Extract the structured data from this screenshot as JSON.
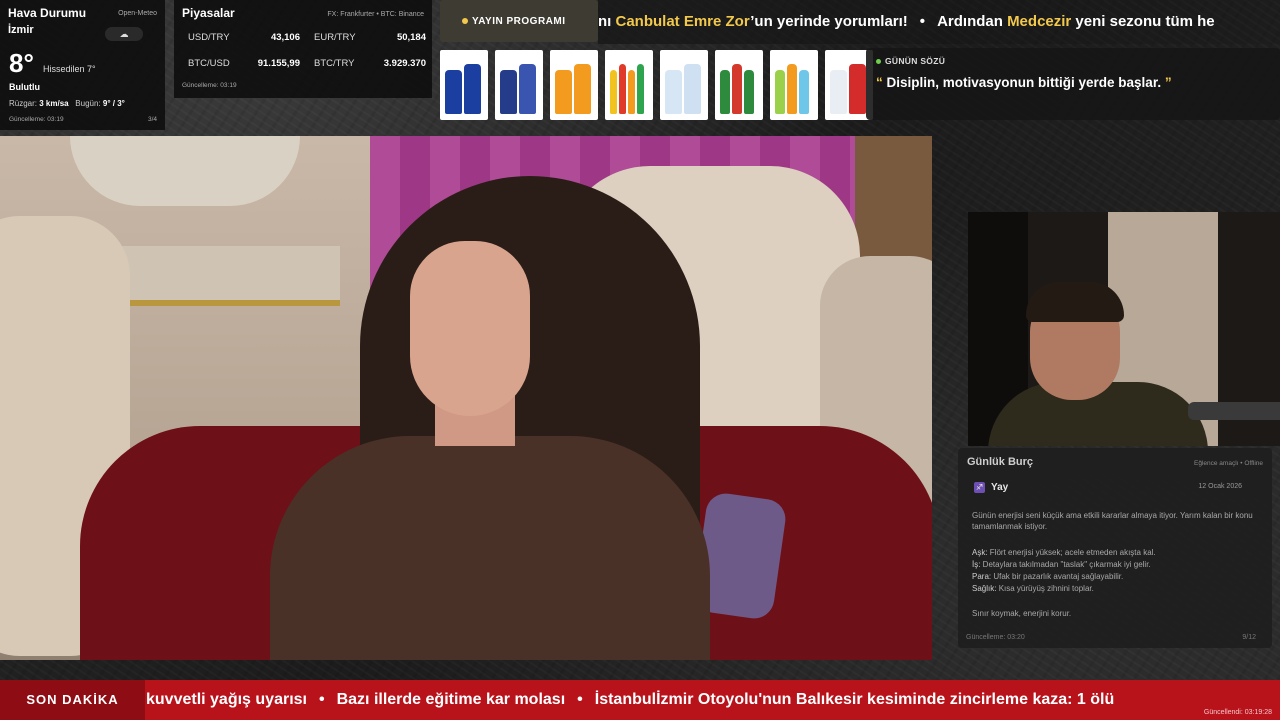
{
  "weather": {
    "title": "Hava Durumu",
    "source": "Open-Meteo",
    "city": "İzmir",
    "icon": "cloud-icon",
    "temp": "8°",
    "feels_like": "Hissedilen 7°",
    "condition": "Bulutlu",
    "wind_label": "Rüzgar:",
    "wind_value": "3 km/sa",
    "today_label": "Bugün:",
    "today_value": "9° / 3°",
    "updated": "Güncelleme: 03:19",
    "page": "3/4"
  },
  "markets": {
    "title": "Piyasalar",
    "source": "FX: Frankfurter • BTC: Binance",
    "rows": [
      {
        "key": "USD/TRY",
        "value": "43,106"
      },
      {
        "key": "EUR/TRY",
        "value": "50,184"
      },
      {
        "key": "BTC/USD",
        "value": "91.155,99"
      },
      {
        "key": "BTC/TRY",
        "value": "3.929.370"
      }
    ],
    "updated": "Güncelleme: 03:19"
  },
  "schedule": {
    "label": "YAYIN PROGRAMI",
    "ticker_parts": [
      "nı ",
      "Canbulat Emre Zor",
      "’un yerinde yorumları!",
      "•",
      "Ardından ",
      "Medcezir",
      " yeni sezonu tüm he"
    ]
  },
  "products": [
    {
      "name": "can-product",
      "colors": [
        "#1b3fa0",
        "#1b3fa0"
      ]
    },
    {
      "name": "blue-bottles-product",
      "colors": [
        "#243c8a",
        "#3a55b0"
      ]
    },
    {
      "name": "orange-bottle-product",
      "colors": [
        "#f29b1f",
        "#f29b1f"
      ]
    },
    {
      "name": "mixed-soda-product",
      "colors": [
        "#f2c21f",
        "#e03b2a",
        "#f29b1f",
        "#2fa44f"
      ]
    },
    {
      "name": "water-bottles-product",
      "colors": [
        "#d7e6f5",
        "#cfe0f2"
      ]
    },
    {
      "name": "green-bottles-product",
      "colors": [
        "#2e8b3e",
        "#d33a2c",
        "#2e8b3e"
      ]
    },
    {
      "name": "fruit-soda-product",
      "colors": [
        "#9bd14a",
        "#f29b1f",
        "#6ec6e8"
      ]
    },
    {
      "name": "red-bottle-product",
      "colors": [
        "#e8eef3",
        "#d42b2b"
      ]
    }
  ],
  "quote": {
    "label": "GÜNÜN SÖZÜ",
    "open": "“",
    "text": "Disiplin, motivasyonun bittiği yerde başlar.",
    "close": "”"
  },
  "horoscope": {
    "title": "Günlük Burç",
    "source": "Eğlence amaçlı • Offline",
    "sign": "Yay",
    "date": "12 Ocak 2026",
    "summary": "Günün enerjisi seni küçük ama etkili kararlar almaya itiyor. Yarım kalan bir konu tamamlanmak istiyor.",
    "items": [
      {
        "k": "Aşk:",
        "v": " Flört enerjisi yüksek; acele etmeden akışta kal."
      },
      {
        "k": "İş:",
        "v": " Detaylara takılmadan \"taslak\" çıkarmak iyi gelir."
      },
      {
        "k": "Para:",
        "v": " Ufak bir pazarlık avantaj sağlayabilir."
      },
      {
        "k": "Sağlık:",
        "v": " Kısa yürüyüş zihnini toplar."
      }
    ],
    "advice": "Sınır koymak, enerjini korur.",
    "updated": "Güncelleme: 03:20",
    "page": "9/12"
  },
  "breaking": {
    "label": "SON DAKİKA",
    "items": [
      "kuvvetli yağış uyarısı",
      "•",
      "Bazı illerde eğitime kar molası",
      "•",
      "İstanbulİzmir Otoyolu'nun Balıkesir kesiminde zincirleme kaza: 1 ölü"
    ],
    "updated": "Güncellendi: 03:19:28"
  }
}
